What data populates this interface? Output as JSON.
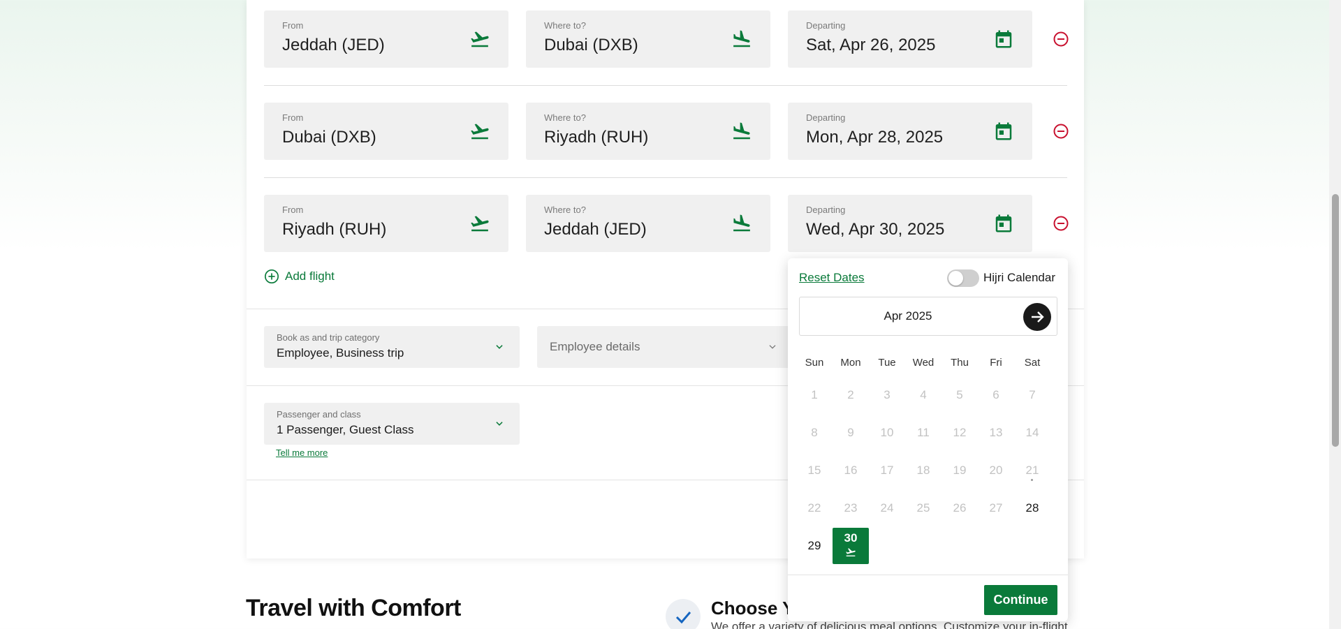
{
  "flights": [
    {
      "from_label": "From",
      "from": "Jeddah (JED)",
      "to_label": "Where to?",
      "to": "Dubai (DXB)",
      "date_label": "Departing",
      "date": "Sat, Apr 26, 2025"
    },
    {
      "from_label": "From",
      "from": "Dubai (DXB)",
      "to_label": "Where to?",
      "to": "Riyadh (RUH)",
      "date_label": "Departing",
      "date": "Mon, Apr 28, 2025"
    },
    {
      "from_label": "From",
      "from": "Riyadh (RUH)",
      "to_label": "Where to?",
      "to": "Jeddah (JED)",
      "date_label": "Departing",
      "date": "Wed, Apr 30, 2025"
    }
  ],
  "add_flight_label": "Add flight",
  "booking": {
    "label": "Book as and trip category",
    "value": "Employee, Business trip"
  },
  "employee": {
    "placeholder": "Employee details"
  },
  "passenger": {
    "label": "Passenger and class",
    "value": "1 Passenger, Guest Class",
    "tell_more": "Tell me more"
  },
  "calendar": {
    "reset_label": "Reset Dates",
    "hijri_label": "Hijri Calendar",
    "hijri_on": false,
    "month_label": "Apr 2025",
    "weekdays": [
      "Sun",
      "Mon",
      "Tue",
      "Wed",
      "Thu",
      "Fri",
      "Sat"
    ],
    "days": [
      "1",
      "2",
      "3",
      "4",
      "5",
      "6",
      "7",
      "8",
      "9",
      "10",
      "11",
      "12",
      "13",
      "14",
      "15",
      "16",
      "17",
      "18",
      "19",
      "20",
      "21",
      "22",
      "23",
      "24",
      "25",
      "26",
      "27",
      "28",
      "29",
      "30"
    ],
    "enabled_days": [
      "28",
      "29",
      "30"
    ],
    "selected_day": "30",
    "continue_label": "Continue"
  },
  "footer": {
    "heading": "Travel with Comfort",
    "feature_title": "Choose Yo",
    "feature_text": "We offer a variety of delicious meal options. Customize your in-flight"
  },
  "colors": {
    "accent": "#0a7a3a",
    "remove": "#c8102e"
  }
}
